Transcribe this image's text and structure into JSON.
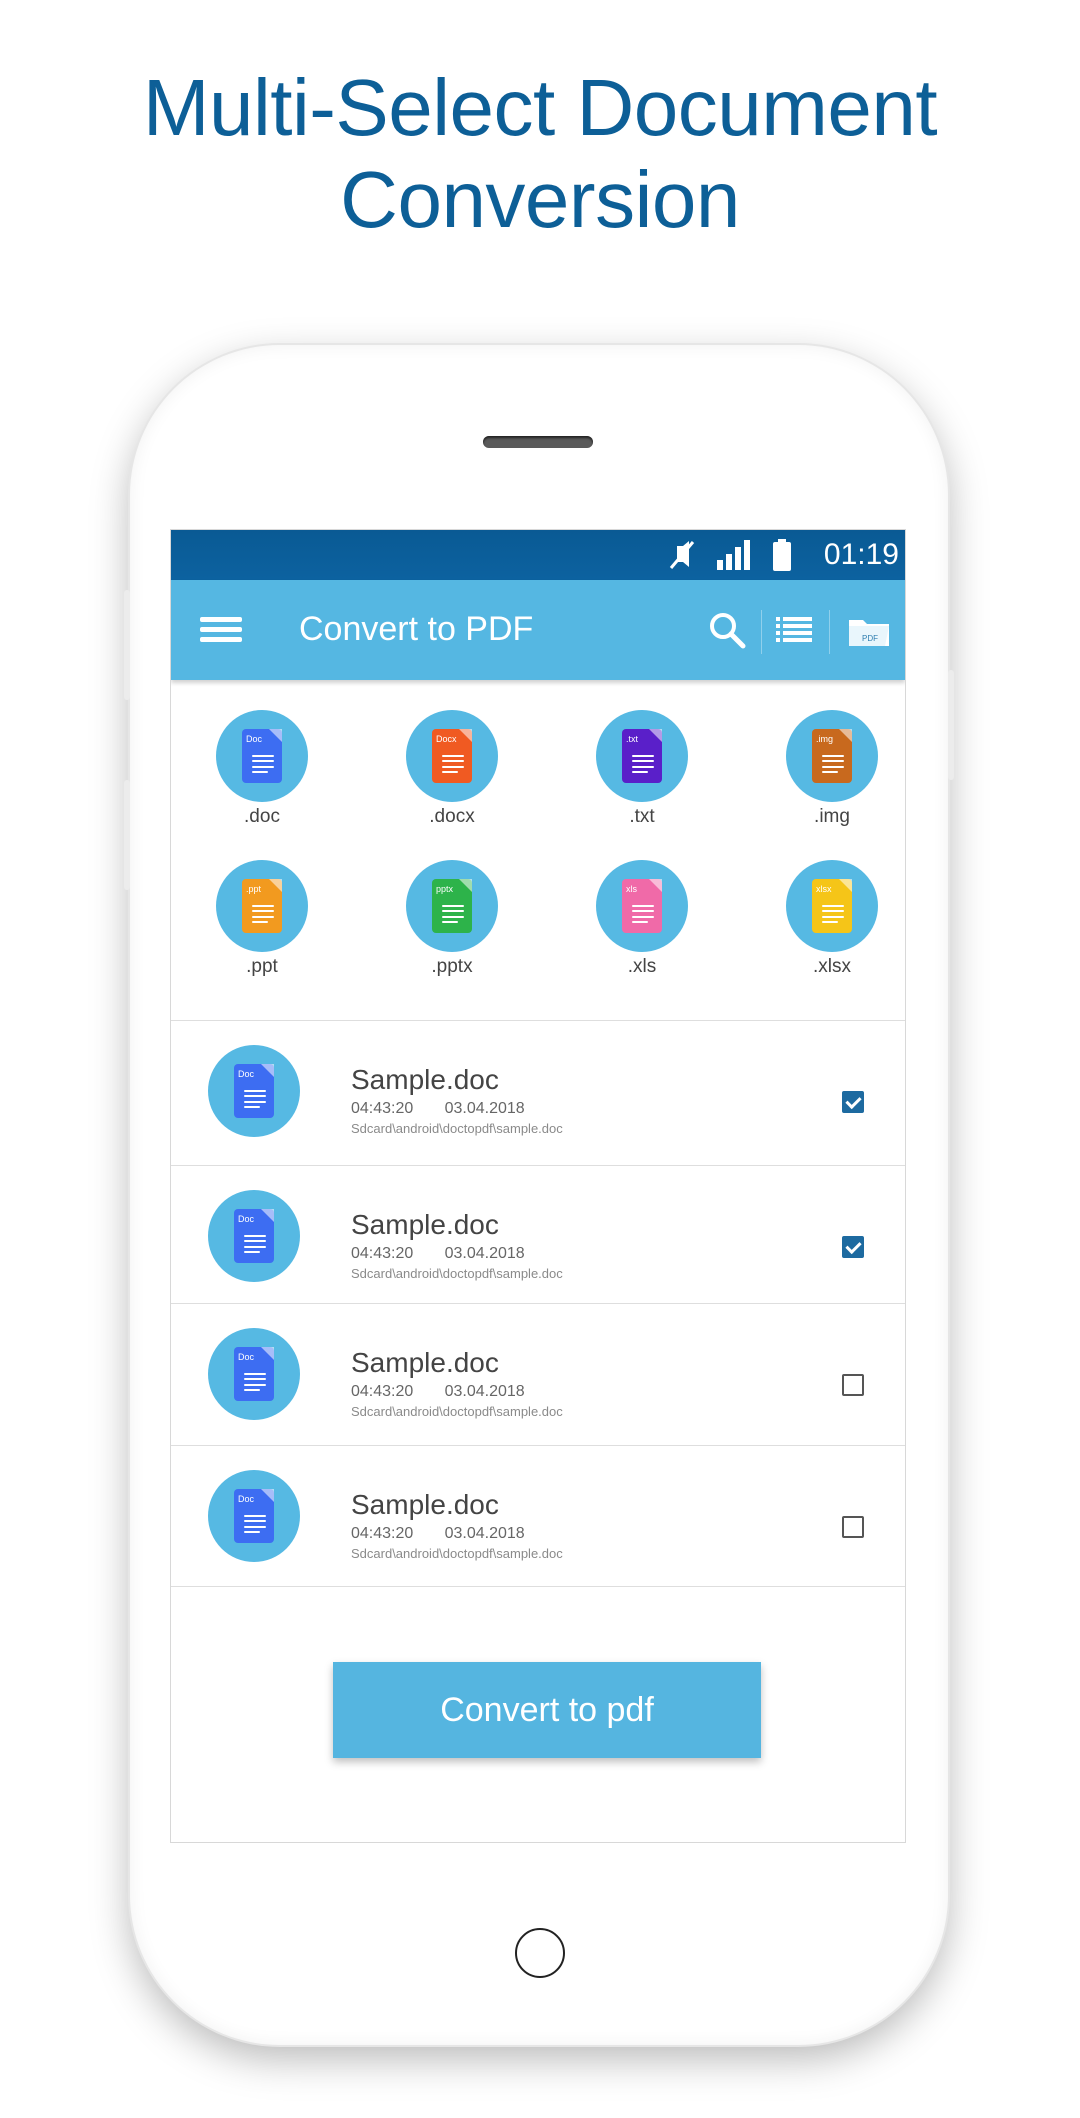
{
  "headline": {
    "line1": "Multi-Select Document",
    "line2": "Conversion"
  },
  "status_bar": {
    "time": "01:19",
    "icons": [
      "mute-icon",
      "signal-icon",
      "battery-icon"
    ]
  },
  "app_bar": {
    "title": "Convert to PDF",
    "menu_icon": "menu-icon",
    "actions": [
      "search-icon",
      "list-view-icon",
      "pdf-folder-icon"
    ],
    "folder_badge": "PDF"
  },
  "file_types": [
    {
      "label": ".doc",
      "tag": "Doc",
      "color": "#3d6df2"
    },
    {
      "label": ".docx",
      "tag": "Docx",
      "color": "#f05a22"
    },
    {
      "label": ".txt",
      "tag": ".txt",
      "color": "#5a1fc9"
    },
    {
      "label": ".img",
      "tag": ".img",
      "color": "#c8691e"
    },
    {
      "label": ".ppt",
      "tag": ".ppt",
      "color": "#f29a1f"
    },
    {
      "label": ".pptx",
      "tag": "pptx",
      "color": "#2db34a"
    },
    {
      "label": ".xls",
      "tag": "xls",
      "color": "#f06aa8"
    },
    {
      "label": ".xlsx",
      "tag": "xlsx",
      "color": "#f5c518"
    }
  ],
  "files": [
    {
      "name": "Sample.doc",
      "time": "04:43:20",
      "date": "03.04.2018",
      "path": "Sdcard\\android\\doctopdf\\sample.doc",
      "tag": "Doc",
      "checked": true
    },
    {
      "name": "Sample.doc",
      "time": "04:43:20",
      "date": "03.04.2018",
      "path": "Sdcard\\android\\doctopdf\\sample.doc",
      "tag": "Doc",
      "checked": true
    },
    {
      "name": "Sample.doc",
      "time": "04:43:20",
      "date": "03.04.2018",
      "path": "Sdcard\\android\\doctopdf\\sample.doc",
      "tag": "Doc",
      "checked": false
    },
    {
      "name": "Sample.doc",
      "time": "04:43:20",
      "date": "03.04.2018",
      "path": "Sdcard\\android\\doctopdf\\sample.doc",
      "tag": "Doc",
      "checked": false
    }
  ],
  "convert_button": {
    "label": "Convert to pdf"
  },
  "colors": {
    "headline": "#0d5f97",
    "status_bar": "#0a5a94",
    "app_bar": "#55b7e2",
    "accent_circle": "#56b9e3",
    "checkbox": "#1d6aa0"
  }
}
